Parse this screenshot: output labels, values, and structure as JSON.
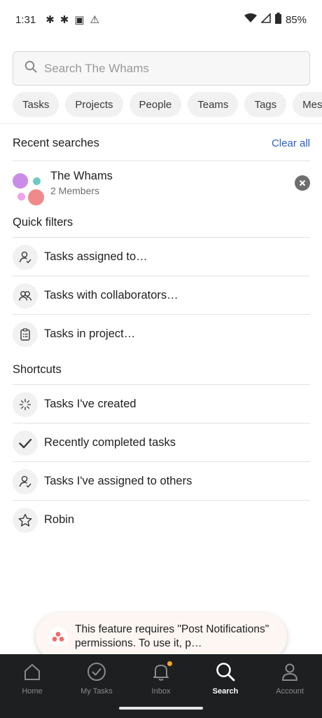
{
  "status_bar": {
    "time": "1:31",
    "battery": "85%",
    "notification_icons": [
      "slack-icon",
      "slack-icon",
      "calendar-icon",
      "warning-icon"
    ]
  },
  "search": {
    "placeholder": "Search The Whams",
    "value": ""
  },
  "filter_chips": [
    "Tasks",
    "Projects",
    "People",
    "Teams",
    "Tags",
    "Mes"
  ],
  "recent_searches": {
    "title": "Recent searches",
    "clear_label": "Clear all",
    "items": [
      {
        "name": "The Whams",
        "subtitle": "2 Members",
        "colors": [
          "#c98de8",
          "#6fcac6",
          "#f08a8a",
          "#f0a2ec"
        ]
      }
    ]
  },
  "quick_filters": {
    "title": "Quick filters",
    "items": [
      {
        "label": "Tasks assigned to…",
        "icon": "person-check-icon"
      },
      {
        "label": "Tasks with collaborators…",
        "icon": "people-icon"
      },
      {
        "label": "Tasks in project…",
        "icon": "clipboard-icon"
      }
    ]
  },
  "shortcuts": {
    "title": "Shortcuts",
    "items": [
      {
        "label": "Tasks I've created",
        "icon": "sparkle-icon"
      },
      {
        "label": "Recently completed tasks",
        "icon": "checkmark-icon"
      },
      {
        "label": "Tasks I've assigned to others",
        "icon": "person-check-icon"
      },
      {
        "label": "Robin",
        "icon": "star-icon"
      }
    ]
  },
  "toast": {
    "message": "This feature requires \"Post Notifications\" permissions. To use it, p…",
    "icon": "asana-logo-icon",
    "accent": "#f06a6a"
  },
  "bottom_nav": {
    "items": [
      {
        "label": "Home",
        "icon": "home-icon"
      },
      {
        "label": "My Tasks",
        "icon": "check-circle-icon"
      },
      {
        "label": "Inbox",
        "icon": "bell-icon"
      },
      {
        "label": "Search",
        "icon": "search-icon"
      },
      {
        "label": "Account",
        "icon": "account-icon"
      }
    ],
    "active": "Search"
  },
  "colors": {
    "link": "#2a5ec4",
    "nav_bg": "#1e1f21",
    "inbox_badge": "#f5a623"
  }
}
